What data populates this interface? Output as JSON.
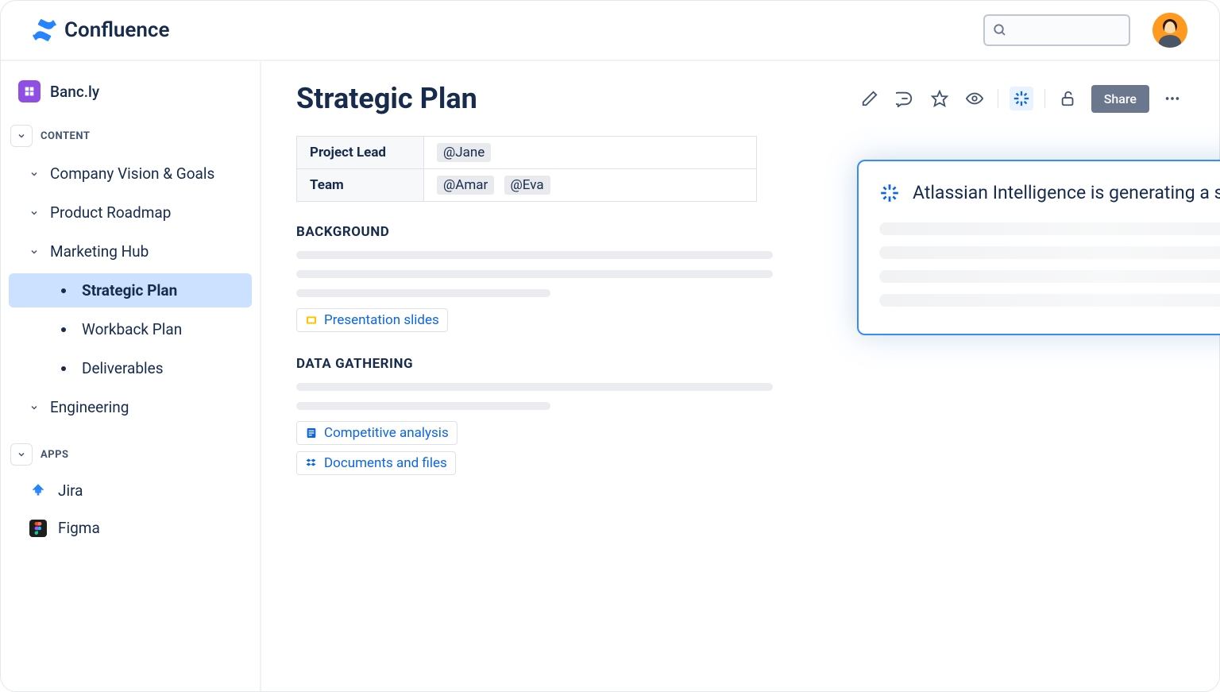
{
  "header": {
    "product": "Confluence"
  },
  "sidebar": {
    "space": "Banc.ly",
    "section_content": "CONTENT",
    "section_apps": "APPS",
    "items": [
      {
        "label": "Company Vision & Goals"
      },
      {
        "label": "Product Roadmap"
      },
      {
        "label": "Marketing Hub"
      },
      {
        "label": "Engineering"
      }
    ],
    "subitems": [
      {
        "label": "Strategic Plan"
      },
      {
        "label": "Workback Plan"
      },
      {
        "label": "Deliverables"
      }
    ],
    "apps": [
      {
        "label": "Jira"
      },
      {
        "label": "Figma"
      }
    ]
  },
  "page": {
    "title": "Strategic Plan",
    "share": "Share",
    "meta": {
      "lead_key": "Project Lead",
      "lead_val": "@Jane",
      "team_key": "Team",
      "team_val1": "@Amar",
      "team_val2": "@Eva"
    },
    "sections": {
      "background": "BACKGROUND",
      "data_gathering": "DATA GATHERING"
    },
    "links": {
      "slides": "Presentation slides",
      "competitive": "Competitive analysis",
      "docs": "Documents and files"
    }
  },
  "ai": {
    "message": "Atlassian Intelligence is generating a summary..."
  }
}
